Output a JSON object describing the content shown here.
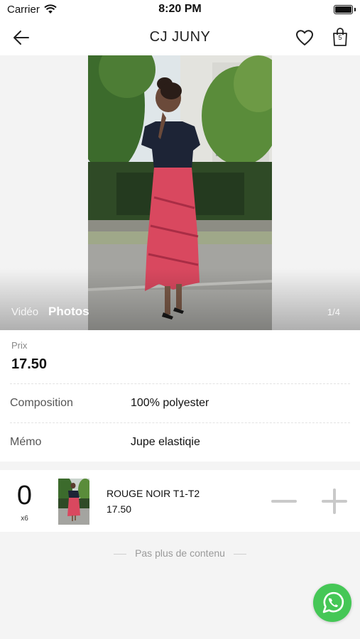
{
  "status_bar": {
    "carrier": "Carrier",
    "time": "8:20 PM"
  },
  "header": {
    "title": "CJ JUNY",
    "cart_count": "5"
  },
  "gallery": {
    "tab_video": "Vidéo",
    "tab_photos": "Photos",
    "counter": "1/4"
  },
  "product": {
    "price_label": "Prix",
    "price": "17.50",
    "composition_label": "Composition",
    "composition": "100% polyester",
    "memo_label": "Mémo",
    "memo": "Jupe elastiqie"
  },
  "variant": {
    "quantity": "0",
    "pack": "x6",
    "name": "ROUGE NOIR T1-T2",
    "price": "17.50"
  },
  "footer": {
    "end_text": "Pas plus de contenu"
  },
  "colors": {
    "accent_whatsapp": "#45c756",
    "skirt": "#d9485f",
    "top": "#1d2436"
  }
}
